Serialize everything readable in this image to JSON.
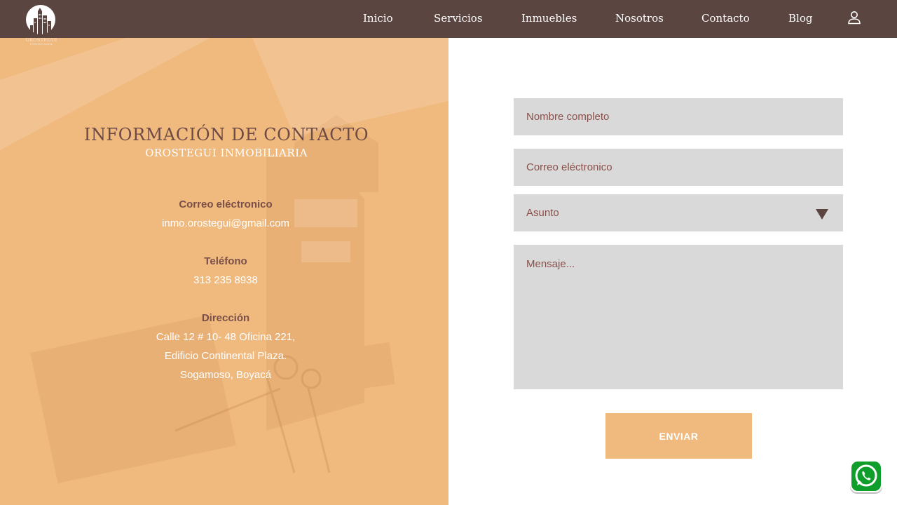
{
  "brand": {
    "name": "OROSTEGUI",
    "tagline": "INMOBILIARIA"
  },
  "nav": {
    "items": [
      "Inicio",
      "Servicios",
      "Inmuebles",
      "Nosotros",
      "Contacto",
      "Blog"
    ],
    "user_icon": "user-icon"
  },
  "contact_info": {
    "title": "INFORMACIÓN DE CONTACTO",
    "subtitle": "OROSTEGUI INMOBILIARIA",
    "email_label": "Correo eléctronico",
    "email_value": "inmo.orostegui@gmail.com",
    "phone_label": "Teléfono",
    "phone_value": "313 235 8938",
    "address_label": "Dirección",
    "address_lines": [
      "Calle 12 # 10- 48 Oficina 221,",
      "Edificio Continental Plaza.",
      "Sogamoso, Boyacá"
    ]
  },
  "form": {
    "name_placeholder": "Nombre completo",
    "email_placeholder": "Correo eléctronico",
    "subject_value": "Asunto",
    "message_placeholder": "Mensaje...",
    "submit_label": "ENVIAR"
  },
  "colors": {
    "header_bg": "#5a4541",
    "accent": "#f0b97e",
    "field_bg": "#d9d9d9",
    "field_text": "#8a4f4a",
    "whatsapp": "#25d366"
  },
  "icons": {
    "whatsapp": "whatsapp-icon",
    "dropdown": "caret-down-icon"
  }
}
